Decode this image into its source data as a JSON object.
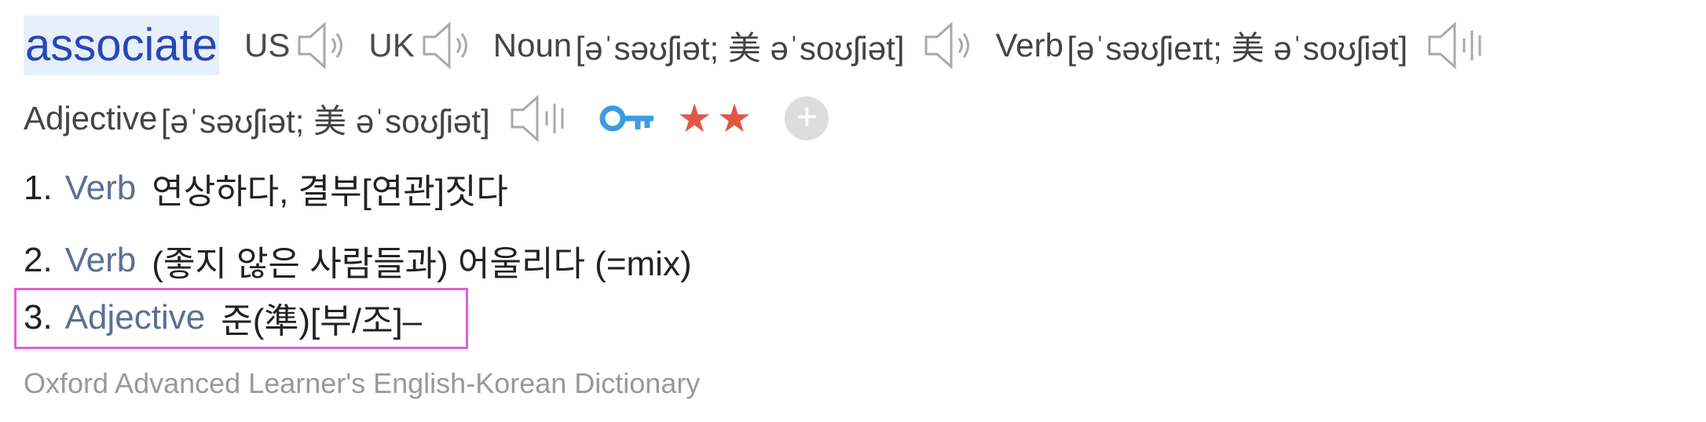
{
  "entry": {
    "headword": "associate",
    "pron_us_label": "US",
    "pron_uk_label": "UK",
    "forms": [
      {
        "pos": "Noun",
        "ipa": "[əˈsəʊʃiət; 美 əˈsoʊʃiət]"
      },
      {
        "pos": "Verb",
        "ipa": "[əˈsəʊʃieɪt; 美 əˈsoʊʃiət]"
      },
      {
        "pos": "Adjective",
        "ipa": "[əˈsəʊʃiət; 美 əˈsoʊʃiət]"
      }
    ],
    "rating_stars": "★★",
    "rating_value": 2,
    "add_symbol": "+"
  },
  "definitions": [
    {
      "num": "1.",
      "pos": "Verb",
      "text": "연상하다, 결부[연관]짓다"
    },
    {
      "num": "2.",
      "pos": "Verb",
      "text": "(좋지 않은 사람들과) 어울리다 (=mix)"
    },
    {
      "num": "3.",
      "pos": "Adjective",
      "text": "준(準)[부/조]–"
    }
  ],
  "source": "Oxford Advanced Learner's English-Korean Dictionary",
  "colors": {
    "headword": "#2a45b8",
    "headword_bg": "#e6f0fb",
    "pos_label": "#5a7094",
    "stars": "#e0574a",
    "key_icon": "#3d9be0",
    "highlight_border": "#e05fde",
    "source_text": "#999999"
  },
  "icons": [
    "speaker-icon",
    "speaker-playing-icon",
    "key-icon",
    "star-icon",
    "add-icon"
  ]
}
